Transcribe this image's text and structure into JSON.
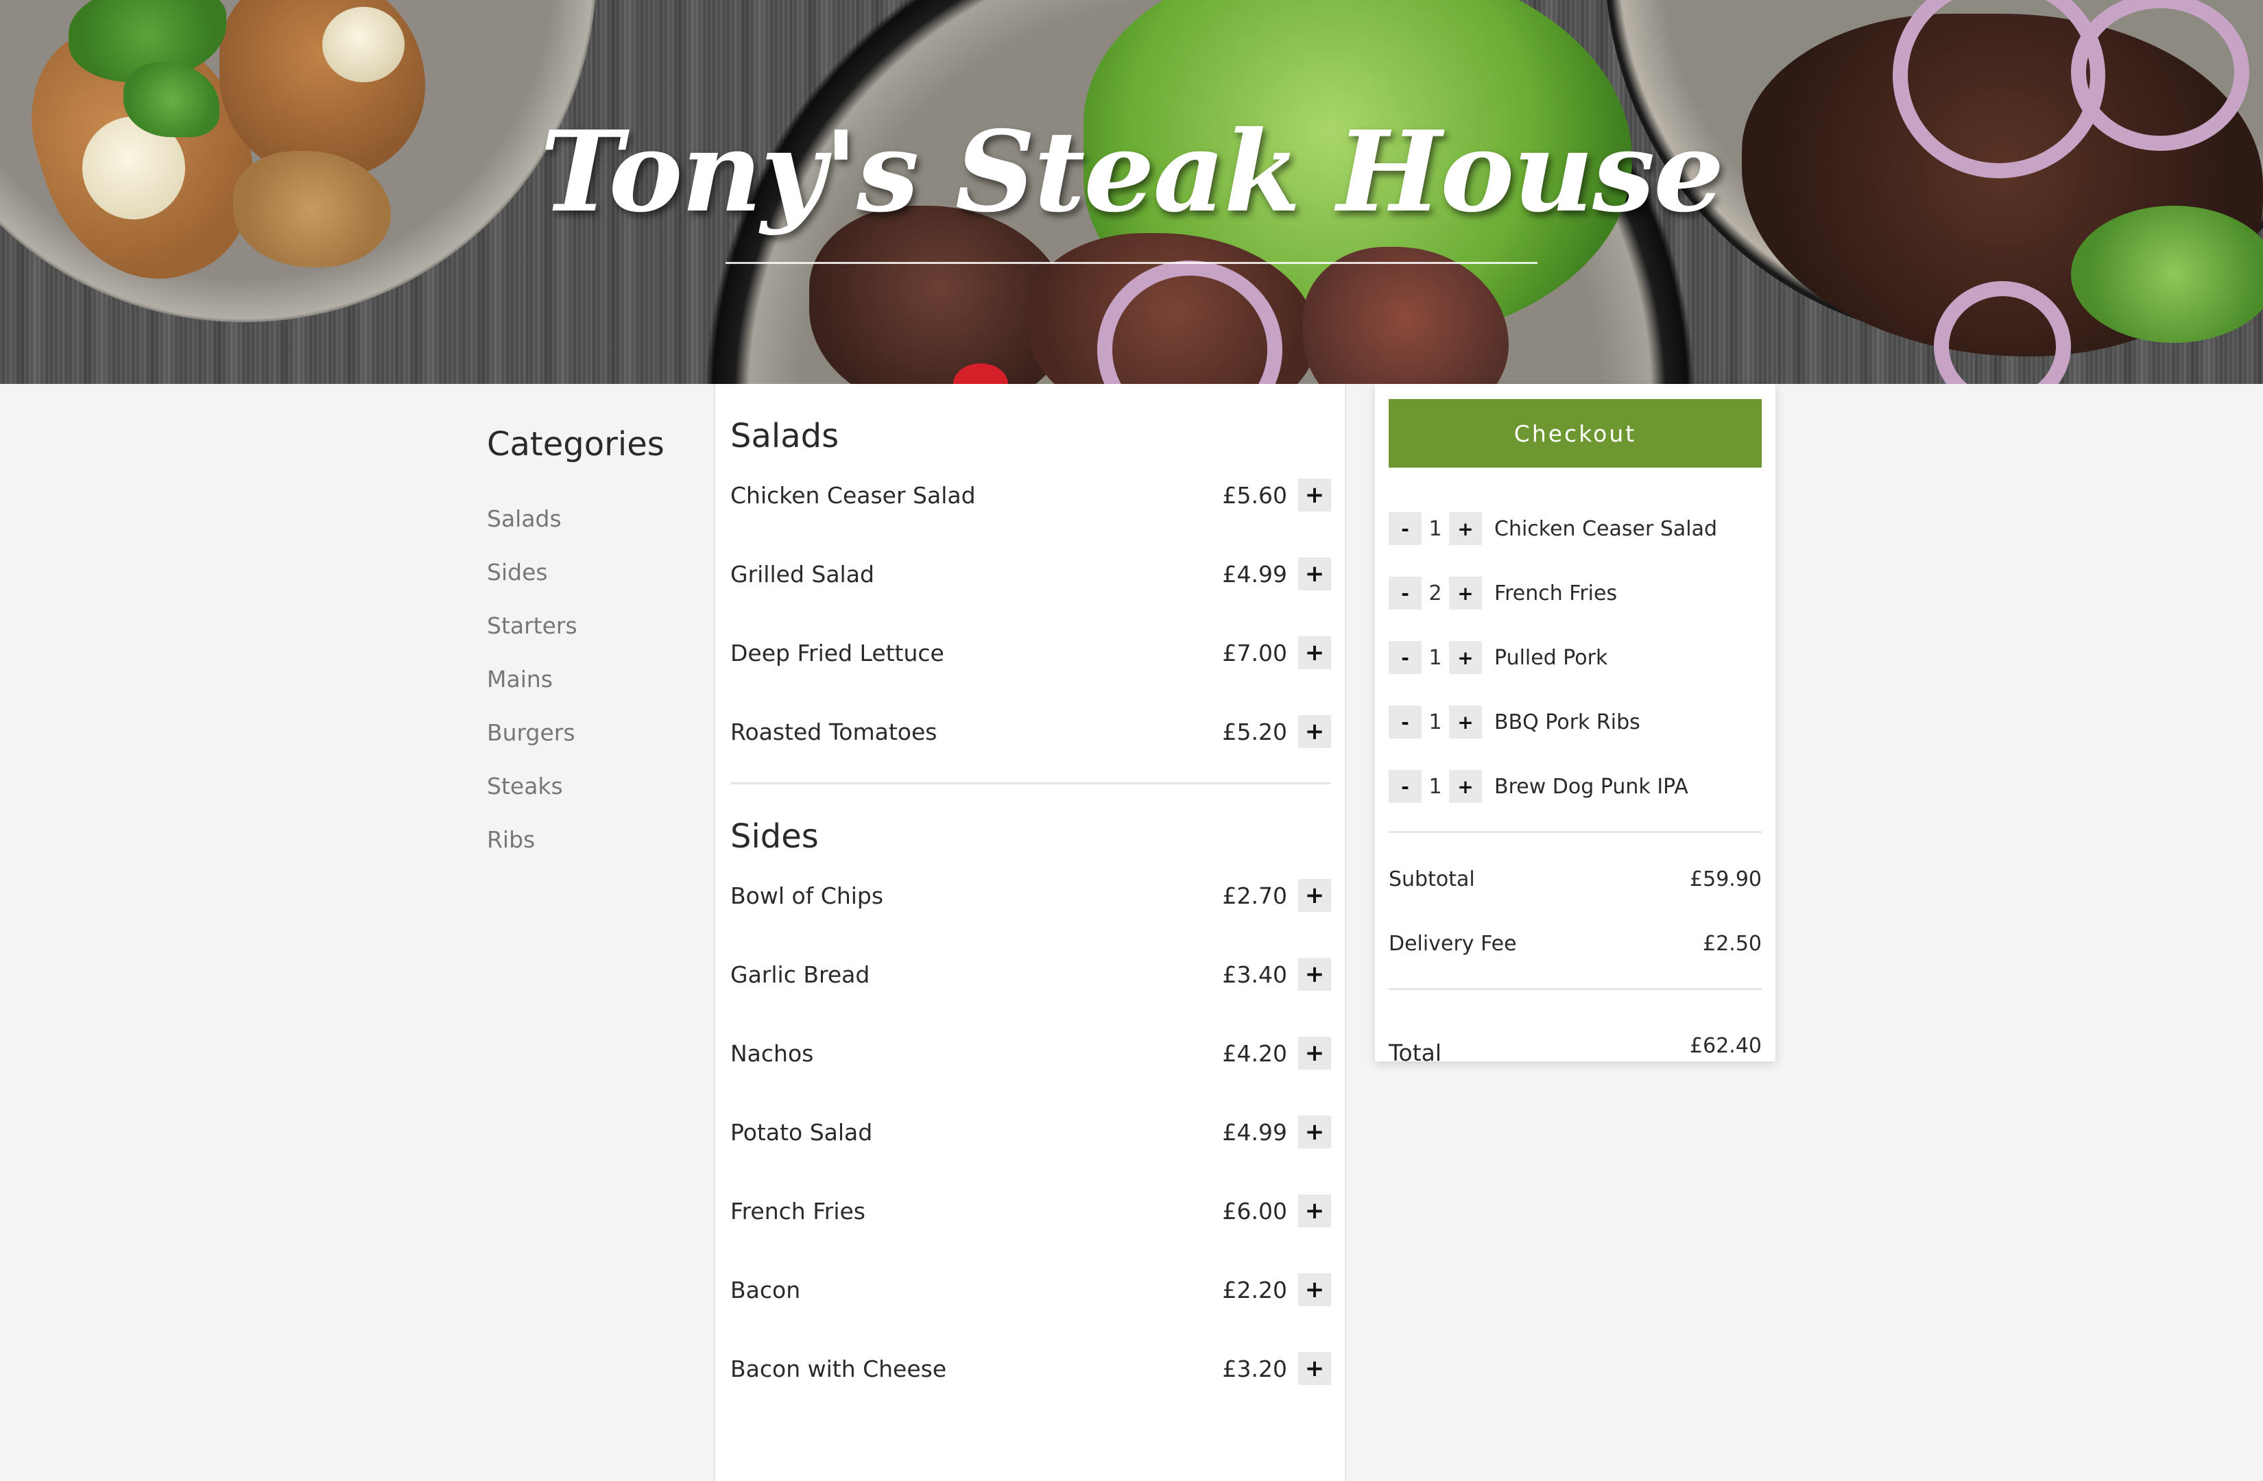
{
  "hero": {
    "title": "Tony's Steak House"
  },
  "categories": {
    "heading": "Categories",
    "items": [
      {
        "label": "Salads"
      },
      {
        "label": "Sides"
      },
      {
        "label": "Starters"
      },
      {
        "label": "Mains"
      },
      {
        "label": "Burgers"
      },
      {
        "label": "Steaks"
      },
      {
        "label": "Ribs"
      }
    ]
  },
  "menu": {
    "sections": [
      {
        "title": "Salads",
        "items": [
          {
            "name": "Chicken Ceaser Salad",
            "price": "£5.60",
            "add_label": "+"
          },
          {
            "name": "Grilled Salad",
            "price": "£4.99",
            "add_label": "+"
          },
          {
            "name": "Deep Fried Lettuce",
            "price": "£7.00",
            "add_label": "+"
          },
          {
            "name": "Roasted Tomatoes",
            "price": "£5.20",
            "add_label": "+"
          }
        ]
      },
      {
        "title": "Sides",
        "items": [
          {
            "name": "Bowl of Chips",
            "price": "£2.70",
            "add_label": "+"
          },
          {
            "name": "Garlic Bread",
            "price": "£3.40",
            "add_label": "+"
          },
          {
            "name": "Nachos",
            "price": "£4.20",
            "add_label": "+"
          },
          {
            "name": "Potato Salad",
            "price": "£4.99",
            "add_label": "+"
          },
          {
            "name": "French Fries",
            "price": "£6.00",
            "add_label": "+"
          },
          {
            "name": "Bacon",
            "price": "£2.20",
            "add_label": "+"
          },
          {
            "name": "Bacon with Cheese",
            "price": "£3.20",
            "add_label": "+"
          }
        ]
      }
    ]
  },
  "cart": {
    "checkout_label": "Checkout",
    "decrement_label": "-",
    "increment_label": "+",
    "items": [
      {
        "qty": "1",
        "name": "Chicken Ceaser Salad"
      },
      {
        "qty": "2",
        "name": "French Fries"
      },
      {
        "qty": "1",
        "name": "Pulled Pork"
      },
      {
        "qty": "1",
        "name": "BBQ Pork Ribs"
      },
      {
        "qty": "1",
        "name": "Brew Dog Punk IPA"
      }
    ],
    "subtotal_label": "Subtotal",
    "subtotal_value": "£59.90",
    "delivery_label": "Delivery Fee",
    "delivery_value": "£2.50",
    "total_label": "Total",
    "total_value": "£62.40"
  },
  "colors": {
    "accent": "#6d9831",
    "page_background": "#f4f4f4"
  }
}
